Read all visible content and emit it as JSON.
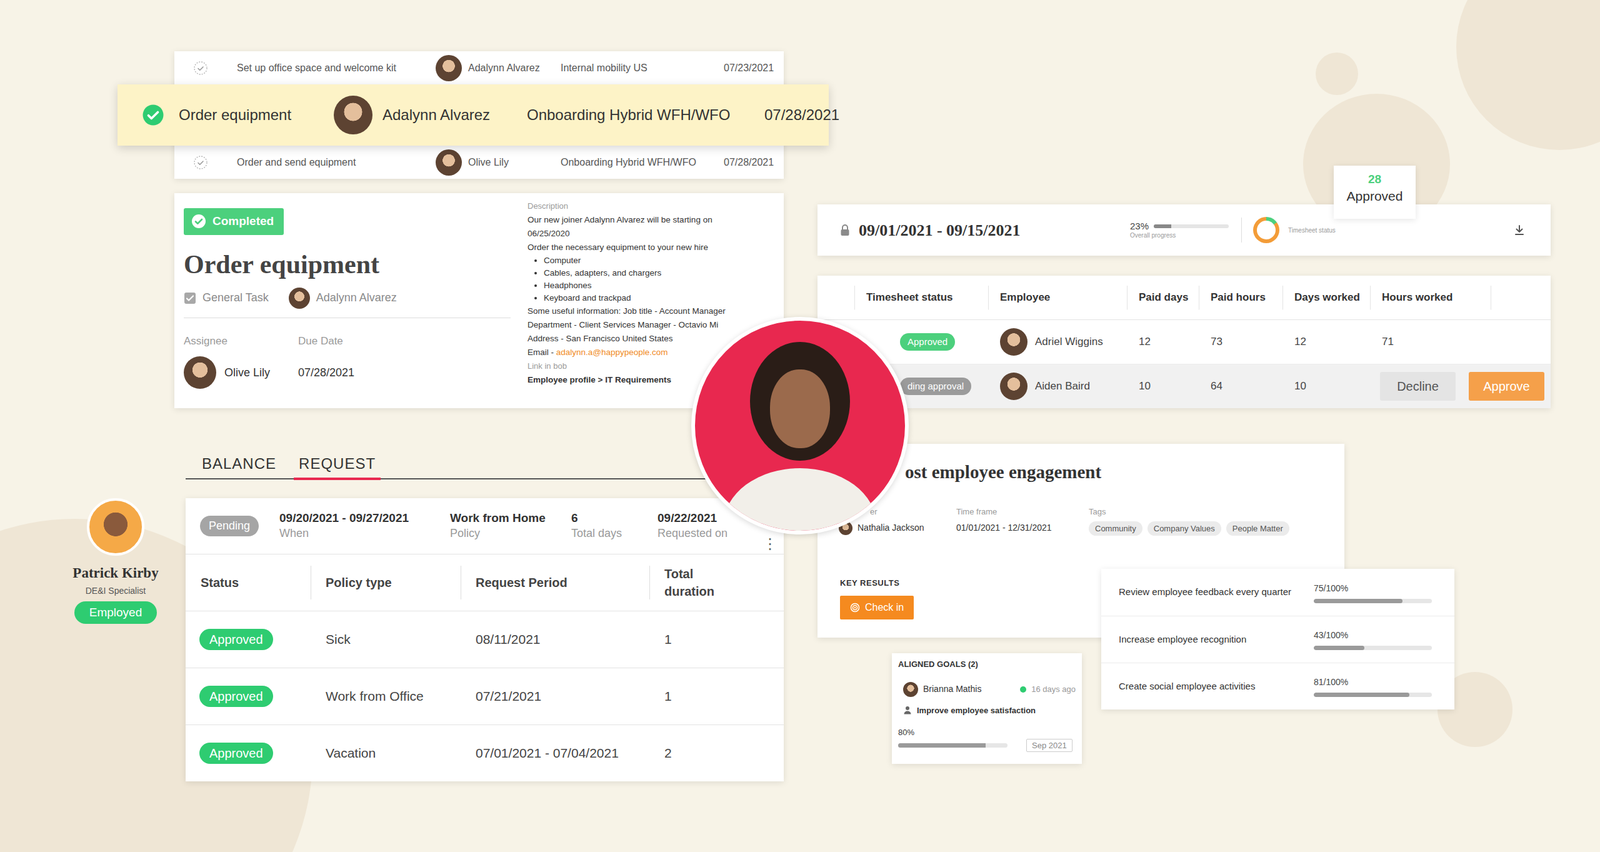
{
  "task_list": {
    "rows": [
      {
        "done": false,
        "highlighted": false,
        "task": "Set up office space and welcome kit",
        "person": "Adalynn Alvarez",
        "flow": "Internal mobility US",
        "date": "07/23/2021"
      },
      {
        "done": true,
        "highlighted": true,
        "task": "Order equipment",
        "person": "Adalynn Alvarez",
        "flow": "Onboarding Hybrid WFH/WFO",
        "date": "07/28/2021"
      },
      {
        "done": false,
        "highlighted": false,
        "task": "Order and send equipment",
        "person": "Olive Lily",
        "flow": "Onboarding Hybrid WFH/WFO",
        "date": "07/28/2021"
      }
    ]
  },
  "task_detail": {
    "status": "Completed",
    "title": "Order equipment",
    "type": "General Task",
    "type_checked": true,
    "person": "Adalynn Alvarez",
    "assignee_label": "Assignee",
    "assignee": "Olive Lily",
    "due_label": "Due Date",
    "due": "07/28/2021",
    "description_label": "Description",
    "intro": [
      "Our new joiner Adalynn Alvarez will be starting on",
      "06/25/2020",
      "Order the necessary equipment to your new hire"
    ],
    "bullets": [
      "Computer",
      "Cables, adapters, and chargers",
      "Headphones",
      "Keyboard and trackpad"
    ],
    "info": [
      "Some useful information: Job title - Account Manager",
      "Department - Client Services Manager - Octavio Mi",
      "Address - San Francisco United States"
    ],
    "email_label": "Email - ",
    "email": "adalynn.a@happypeople.com",
    "link_label": "Link in bob",
    "link": "Employee profile > IT Requirements"
  },
  "time_off": {
    "tabs": [
      {
        "label": "BALANCE",
        "selected": false
      },
      {
        "label": "REQUEST",
        "selected": true
      }
    ],
    "request": {
      "status": "Pending",
      "period": "09/20/2021 - 09/27/2021",
      "period_label": "When",
      "policy": "Work from Home",
      "policy_label": "Policy",
      "days": "6",
      "days_label": "Total days",
      "requested": "09/22/2021",
      "requested_label": "Requested on",
      "menu": "⋮"
    },
    "table": {
      "columns": [
        "Status",
        "Policy type",
        "Request Period",
        "Total duration"
      ],
      "rows": [
        {
          "status": "Approved",
          "color": "#2ecc71",
          "policy": "Sick",
          "period": "08/11/2021",
          "duration": "1"
        },
        {
          "status": "Approved",
          "color": "#2ecc71",
          "policy": "Work from Office",
          "period": "07/21/2021",
          "duration": "1"
        },
        {
          "status": "Approved",
          "color": "#2ecc71",
          "policy": "Vacation",
          "period": "07/01/2021 - 07/04/2021",
          "duration": "2"
        }
      ]
    }
  },
  "profile": {
    "name": "Patrick Kirby",
    "role": "DE&I Specialist",
    "status": "Employed"
  },
  "timesheet": {
    "period": "09/01/2021 - 09/15/2021",
    "progress": "23%",
    "progress_level": 0.23,
    "progress_label": "Overall progress",
    "status_label": "Timesheet status",
    "status_level": 0.15,
    "tooltip": {
      "count": "28",
      "label": "Approved"
    },
    "columns": [
      "Timesheet status",
      "Employee",
      "Paid days",
      "Paid hours",
      "Days worked",
      "Hours worked"
    ],
    "rows": [
      {
        "status": "Approved",
        "color": "#4cd07d",
        "highlighted": false,
        "employee": "Adriel Wiggins",
        "paid_days": "12",
        "paid_hours": "73",
        "days_worked": "12",
        "hours_worked": "71",
        "actions": []
      },
      {
        "status": "ding approval",
        "color": "#9b9b9b",
        "highlighted": true,
        "employee": "Aiden Baird",
        "paid_days": "10",
        "paid_hours": "64",
        "days_worked": "10",
        "hours_worked": "",
        "actions": [
          {
            "label": "Decline",
            "kind": "secondary"
          },
          {
            "label": "Approve",
            "kind": "primary"
          }
        ]
      }
    ]
  },
  "goal": {
    "title": "ost employee engagement",
    "owner_label": "er",
    "owner": "Nathalia Jackson",
    "timeframe_label": "Time frame",
    "timeframe": "01/01/2021 - 12/31/2021",
    "tags_label": "Tags",
    "tags": [
      "Community",
      "Company Values",
      "People Matter"
    ],
    "key_results_label": "KEY RESULTS",
    "check_in": "Check in",
    "key_results": [
      {
        "name": "Review employee feedback every quarter",
        "reading": "75/100%",
        "level": 0.75
      },
      {
        "name": "Increase employee recognition",
        "reading": "43/100%",
        "level": 0.43
      },
      {
        "name": "Create social employee activities",
        "reading": "81/100%",
        "level": 0.81
      }
    ],
    "aligned": {
      "title": "ALIGNED GOALS (2)",
      "person": "Brianna Mathis",
      "time": "16 days ago",
      "goal": "Improve employee satisfaction",
      "reading": "80%",
      "level": 0.8,
      "date": "Sep 2021"
    }
  }
}
